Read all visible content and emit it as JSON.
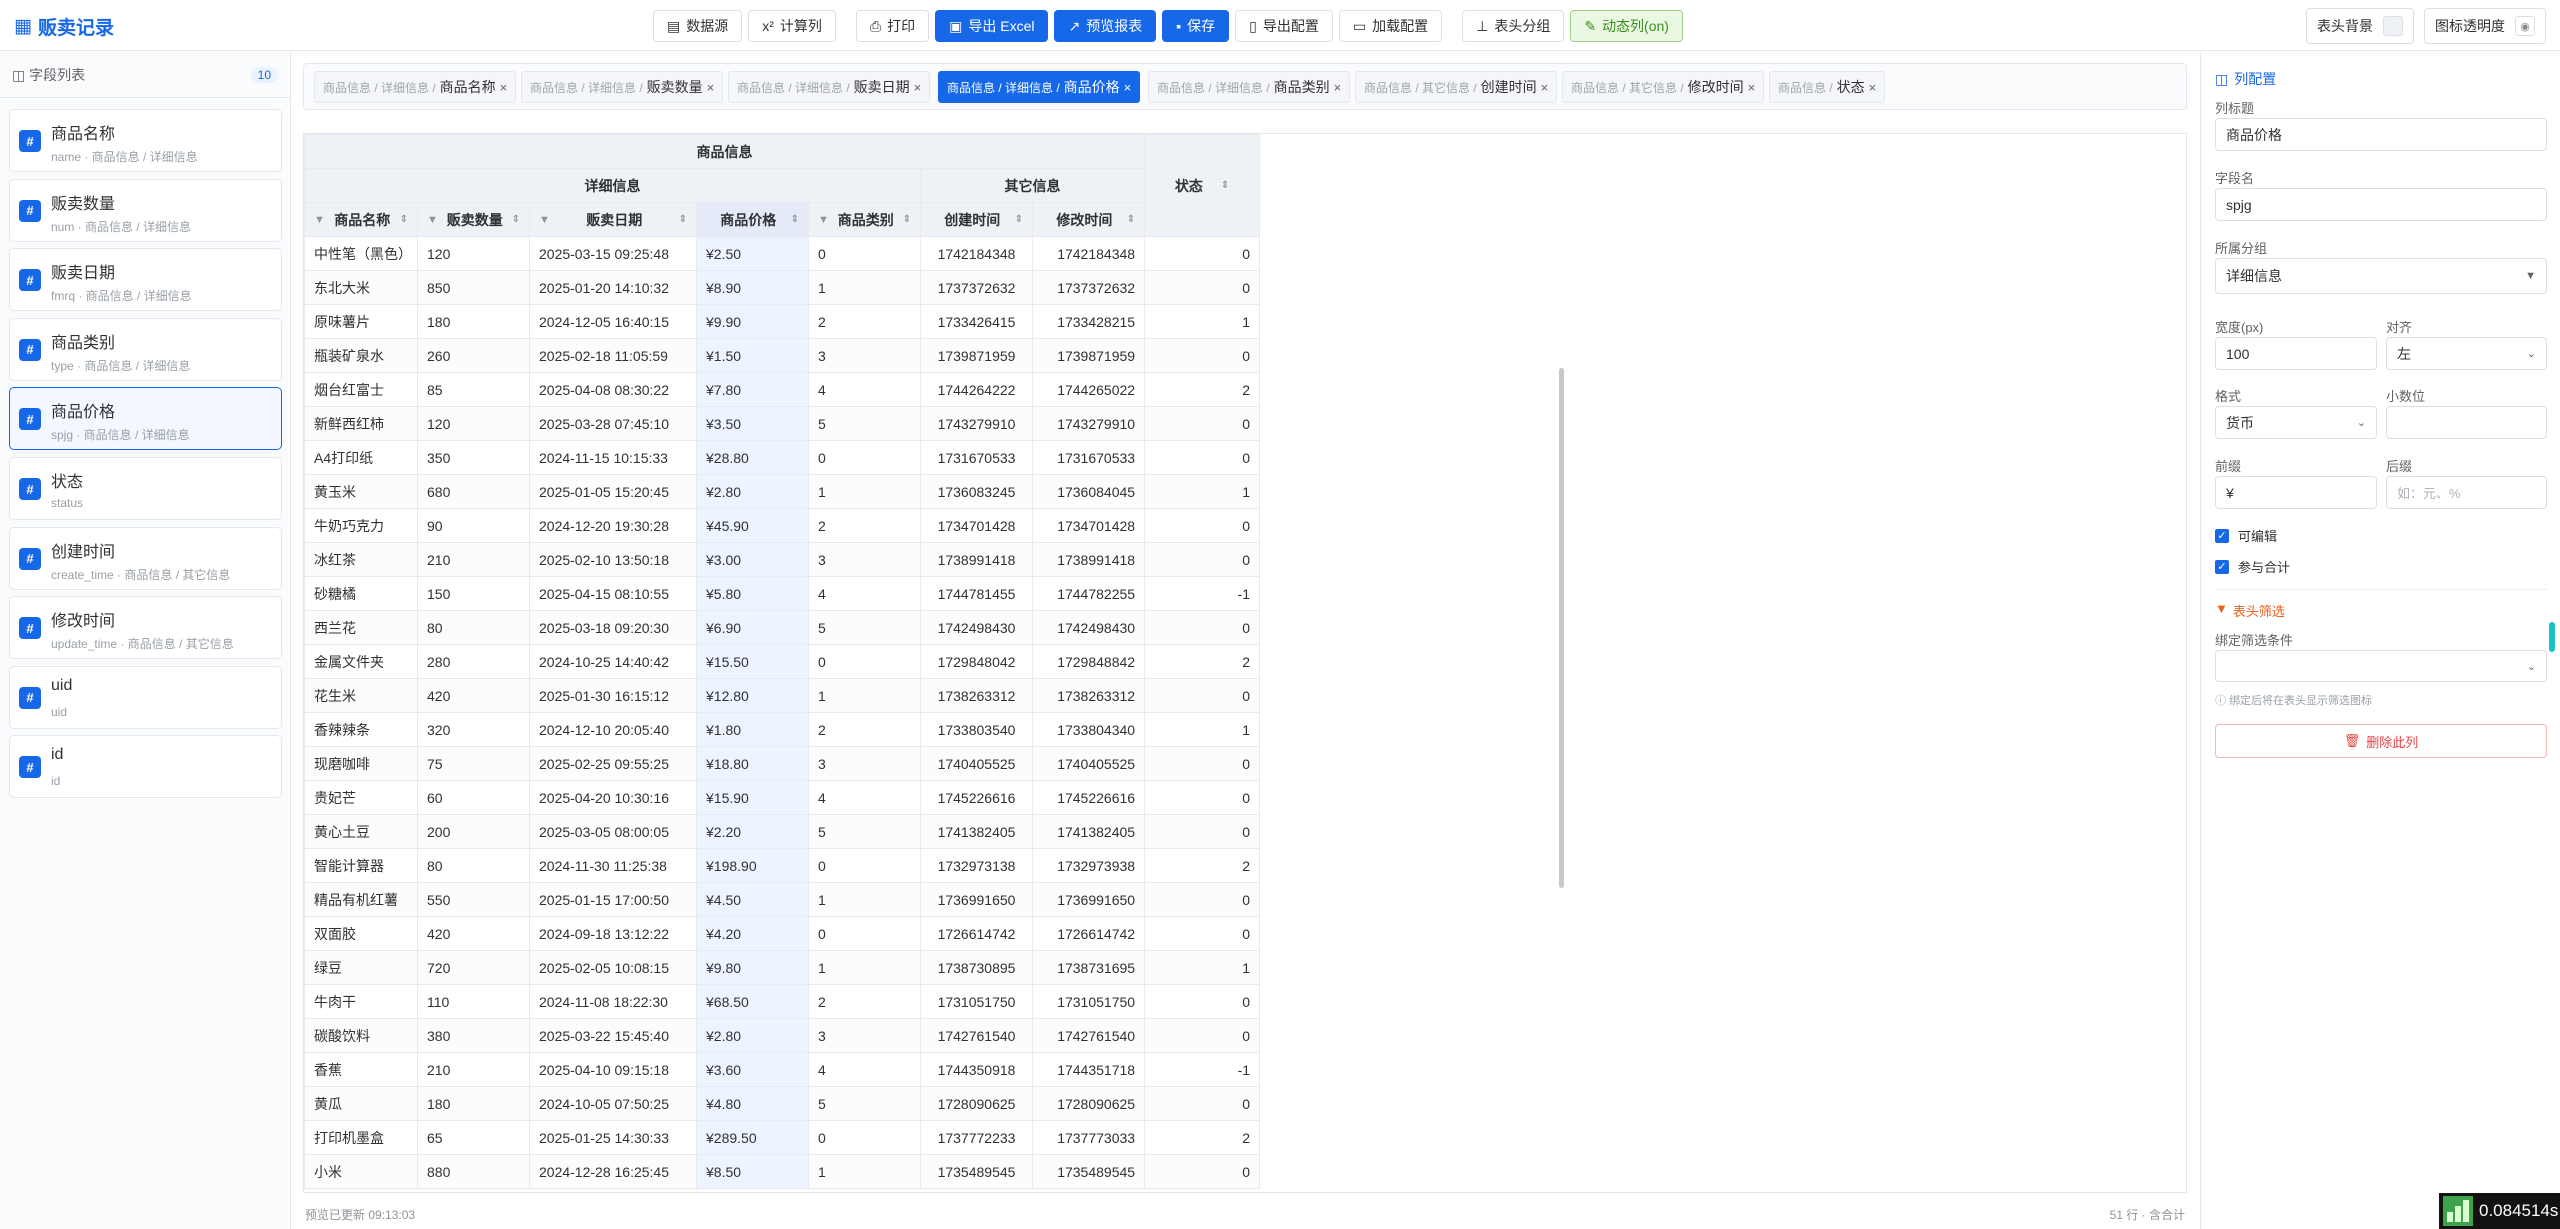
{
  "brand": {
    "title": "贩卖记录"
  },
  "toolbar": {
    "datasource": "数据源",
    "calc_col": "计算列",
    "print": "打印",
    "export_excel": "导出 Excel",
    "preview": "预览报表",
    "save": "保存",
    "export_config": "导出配置",
    "load_config": "加载配置",
    "header_group": "表头分组",
    "dynamic_col": "动态列(on)"
  },
  "toolbar_right": {
    "header_bg": "表头背景",
    "icon_opacity": "图标透明度"
  },
  "sidebar": {
    "title": "字段列表",
    "count": "10",
    "fields": [
      {
        "name": "商品名称",
        "meta": "name · 商品信息 / 详细信息"
      },
      {
        "name": "贩卖数量",
        "meta": "num · 商品信息 / 详细信息"
      },
      {
        "name": "贩卖日期",
        "meta": "fmrq · 商品信息 / 详细信息"
      },
      {
        "name": "商品类别",
        "meta": "type · 商品信息 / 详细信息"
      },
      {
        "name": "商品价格",
        "meta": "spjg · 商品信息 / 详细信息"
      },
      {
        "name": "状态",
        "meta": "status"
      },
      {
        "name": "创建时间",
        "meta": "create_time · 商品信息 / 其它信息"
      },
      {
        "name": "修改时间",
        "meta": "update_time · 商品信息 / 其它信息"
      },
      {
        "name": "uid",
        "meta": "uid"
      },
      {
        "name": "id",
        "meta": "id"
      }
    ]
  },
  "chips": [
    {
      "path": "商品信息 / 详细信息 /",
      "name": "商品名称"
    },
    {
      "path": "商品信息 / 详细信息 /",
      "name": "贩卖数量"
    },
    {
      "path": "商品信息 / 详细信息 /",
      "name": "贩卖日期"
    },
    {
      "path": "商品信息 / 详细信息 /",
      "name": "商品价格"
    },
    {
      "path": "商品信息 / 详细信息 /",
      "name": "商品类别"
    },
    {
      "path": "商品信息 / 其它信息 /",
      "name": "创建时间"
    },
    {
      "path": "商品信息 / 其它信息 /",
      "name": "修改时间"
    },
    {
      "path": "商品信息 /",
      "name": "状态"
    }
  ],
  "table": {
    "group_top": "商品信息",
    "group_detail": "详细信息",
    "group_other": "其它信息",
    "headers": [
      "商品名称",
      "贩卖数量",
      "贩卖日期",
      "商品价格",
      "商品类别",
      "创建时间",
      "修改时间",
      "状态"
    ],
    "rows": [
      [
        "中性笔（黑色）",
        "120",
        "2025-03-15 09:25:48",
        "¥2.50",
        "0",
        "1742184348",
        "1742184348",
        "0"
      ],
      [
        "东北大米",
        "850",
        "2025-01-20 14:10:32",
        "¥8.90",
        "1",
        "1737372632",
        "1737372632",
        "0"
      ],
      [
        "原味薯片",
        "180",
        "2024-12-05 16:40:15",
        "¥9.90",
        "2",
        "1733426415",
        "1733428215",
        "1"
      ],
      [
        "瓶装矿泉水",
        "260",
        "2025-02-18 11:05:59",
        "¥1.50",
        "3",
        "1739871959",
        "1739871959",
        "0"
      ],
      [
        "烟台红富士",
        "85",
        "2025-04-08 08:30:22",
        "¥7.80",
        "4",
        "1744264222",
        "1744265022",
        "2"
      ],
      [
        "新鲜西红柿",
        "120",
        "2025-03-28 07:45:10",
        "¥3.50",
        "5",
        "1743279910",
        "1743279910",
        "0"
      ],
      [
        "A4打印纸",
        "350",
        "2024-11-15 10:15:33",
        "¥28.80",
        "0",
        "1731670533",
        "1731670533",
        "0"
      ],
      [
        "黄玉米",
        "680",
        "2025-01-05 15:20:45",
        "¥2.80",
        "1",
        "1736083245",
        "1736084045",
        "1"
      ],
      [
        "牛奶巧克力",
        "90",
        "2024-12-20 19:30:28",
        "¥45.90",
        "2",
        "1734701428",
        "1734701428",
        "0"
      ],
      [
        "冰红茶",
        "210",
        "2025-02-10 13:50:18",
        "¥3.00",
        "3",
        "1738991418",
        "1738991418",
        "0"
      ],
      [
        "砂糖橘",
        "150",
        "2025-04-15 08:10:55",
        "¥5.80",
        "4",
        "1744781455",
        "1744782255",
        "-1"
      ],
      [
        "西兰花",
        "80",
        "2025-03-18 09:20:30",
        "¥6.90",
        "5",
        "1742498430",
        "1742498430",
        "0"
      ],
      [
        "金属文件夹",
        "280",
        "2024-10-25 14:40:42",
        "¥15.50",
        "0",
        "1729848042",
        "1729848842",
        "2"
      ],
      [
        "花生米",
        "420",
        "2025-01-30 16:15:12",
        "¥12.80",
        "1",
        "1738263312",
        "1738263312",
        "0"
      ],
      [
        "香辣辣条",
        "320",
        "2024-12-10 20:05:40",
        "¥1.80",
        "2",
        "1733803540",
        "1733804340",
        "1"
      ],
      [
        "现磨咖啡",
        "75",
        "2025-02-25 09:55:25",
        "¥18.80",
        "3",
        "1740405525",
        "1740405525",
        "0"
      ],
      [
        "贵妃芒",
        "60",
        "2025-04-20 10:30:16",
        "¥15.90",
        "4",
        "1745226616",
        "1745226616",
        "0"
      ],
      [
        "黄心土豆",
        "200",
        "2025-03-05 08:00:05",
        "¥2.20",
        "5",
        "1741382405",
        "1741382405",
        "0"
      ],
      [
        "智能计算器",
        "80",
        "2024-11-30 11:25:38",
        "¥198.90",
        "0",
        "1732973138",
        "1732973938",
        "2"
      ],
      [
        "精品有机红薯",
        "550",
        "2025-01-15 17:00:50",
        "¥4.50",
        "1",
        "1736991650",
        "1736991650",
        "0"
      ],
      [
        "双面胶",
        "420",
        "2024-09-18 13:12:22",
        "¥4.20",
        "0",
        "1726614742",
        "1726614742",
        "0"
      ],
      [
        "绿豆",
        "720",
        "2025-02-05 10:08:15",
        "¥9.80",
        "1",
        "1738730895",
        "1738731695",
        "1"
      ],
      [
        "牛肉干",
        "110",
        "2024-11-08 18:22:30",
        "¥68.50",
        "2",
        "1731051750",
        "1731051750",
        "0"
      ],
      [
        "碳酸饮料",
        "380",
        "2025-03-22 15:45:40",
        "¥2.80",
        "3",
        "1742761540",
        "1742761540",
        "0"
      ],
      [
        "香蕉",
        "210",
        "2025-04-10 09:15:18",
        "¥3.60",
        "4",
        "1744350918",
        "1744351718",
        "-1"
      ],
      [
        "黄瓜",
        "180",
        "2024-10-05 07:50:25",
        "¥4.80",
        "5",
        "1728090625",
        "1728090625",
        "0"
      ],
      [
        "打印机墨盒",
        "65",
        "2025-01-25 14:30:33",
        "¥289.50",
        "0",
        "1737772233",
        "1737773033",
        "2"
      ],
      [
        "小米",
        "880",
        "2024-12-28 16:25:45",
        "¥8.50",
        "1",
        "1735489545",
        "1735489545",
        "0"
      ]
    ]
  },
  "statusbar": {
    "left": "预览已更新 09:13:03",
    "right": "51 行 · 含合计"
  },
  "panel": {
    "title": "列配置",
    "label_title": "列标题",
    "value_title": "商品价格",
    "label_field": "字段名",
    "value_field": "spjg",
    "label_group": "所属分组",
    "value_group": "详细信息",
    "label_width": "宽度(px)",
    "value_width": "100",
    "label_align": "对齐",
    "value_align": "左",
    "label_format": "格式",
    "value_format": "货币",
    "label_decimals": "小数位",
    "value_decimals": "",
    "label_prefix": "前缀",
    "value_prefix": "¥",
    "label_suffix": "后缀",
    "placeholder_suffix": "如：元、%",
    "editable": "可编辑",
    "sum": "参与合计",
    "filter_title": "表头筛选",
    "filter_label": "绑定筛选条件",
    "filter_value": "",
    "hint": "绑定后将在表头显示筛选图标",
    "delete": "删除此列"
  },
  "perf": {
    "value": "0.084514s"
  }
}
